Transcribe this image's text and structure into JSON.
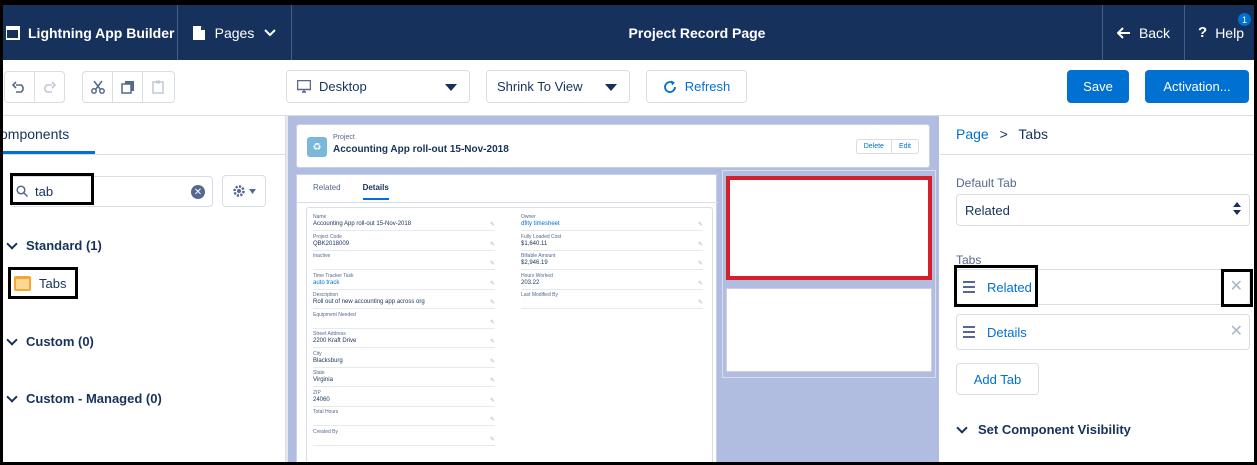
{
  "topbar": {
    "app_title": "Lightning App Builder",
    "pages_label": "Pages",
    "page_title": "Project Record Page",
    "back_label": "Back",
    "help_label": "Help",
    "help_badge": "1"
  },
  "toolbar": {
    "device_select": "Desktop",
    "view_select": "Shrink To View",
    "refresh_label": "Refresh",
    "save_label": "Save",
    "activation_label": "Activation..."
  },
  "left": {
    "tab_label": "omponents",
    "search_value": "tab",
    "sections": [
      {
        "label": "Standard (1)"
      },
      {
        "label": "Custom (0)"
      },
      {
        "label": "Custom - Managed (0)"
      }
    ],
    "standard_items": [
      {
        "label": "Tabs"
      }
    ]
  },
  "canvas": {
    "object_label": "Project",
    "record_name": "Accounting App roll-out 15-Nov-2018",
    "header_buttons": [
      "Delete",
      "Edit"
    ],
    "tabs": [
      "Related",
      "Details"
    ],
    "fields_left": [
      {
        "label": "Name",
        "value": "Accounting App roll-out 15-Nov-2018"
      },
      {
        "label": "Project Code",
        "value": "QBK2018009"
      },
      {
        "label": "Inactive",
        "value": ""
      },
      {
        "label": "Time Tracker Task",
        "value": "auto track"
      },
      {
        "label": "Description",
        "value": "Roll out of new accounting app across org"
      },
      {
        "label": "Equipment Needed",
        "value": ""
      },
      {
        "label": "Street Address",
        "value": "2200 Kraft Drive"
      },
      {
        "label": "City",
        "value": "Blacksburg"
      },
      {
        "label": "State",
        "value": "Virginia"
      },
      {
        "label": "ZIP",
        "value": "24060"
      },
      {
        "label": "Total Hours",
        "value": ""
      },
      {
        "label": "Created By",
        "value": ""
      }
    ],
    "fields_right": [
      {
        "label": "Owner",
        "value": "dfity timesheet"
      },
      {
        "label": "Fully Loaded Cost",
        "value": "$1,640.11"
      },
      {
        "label": "Billable Amount",
        "value": "$2,946.19"
      },
      {
        "label": "Hours Worked",
        "value": "203.22"
      },
      {
        "label": "Last Modified By",
        "value": ""
      }
    ]
  },
  "right": {
    "breadcrumb_link": "Page",
    "breadcrumb_sep": ">",
    "breadcrumb_current": "Tabs",
    "default_tab_label": "Default Tab",
    "default_tab_value": "Related",
    "tabs_label": "Tabs",
    "tabs": [
      {
        "label": "Related"
      },
      {
        "label": "Details"
      }
    ],
    "add_tab_label": "Add Tab",
    "visibility_label": "Set Component Visibility"
  }
}
